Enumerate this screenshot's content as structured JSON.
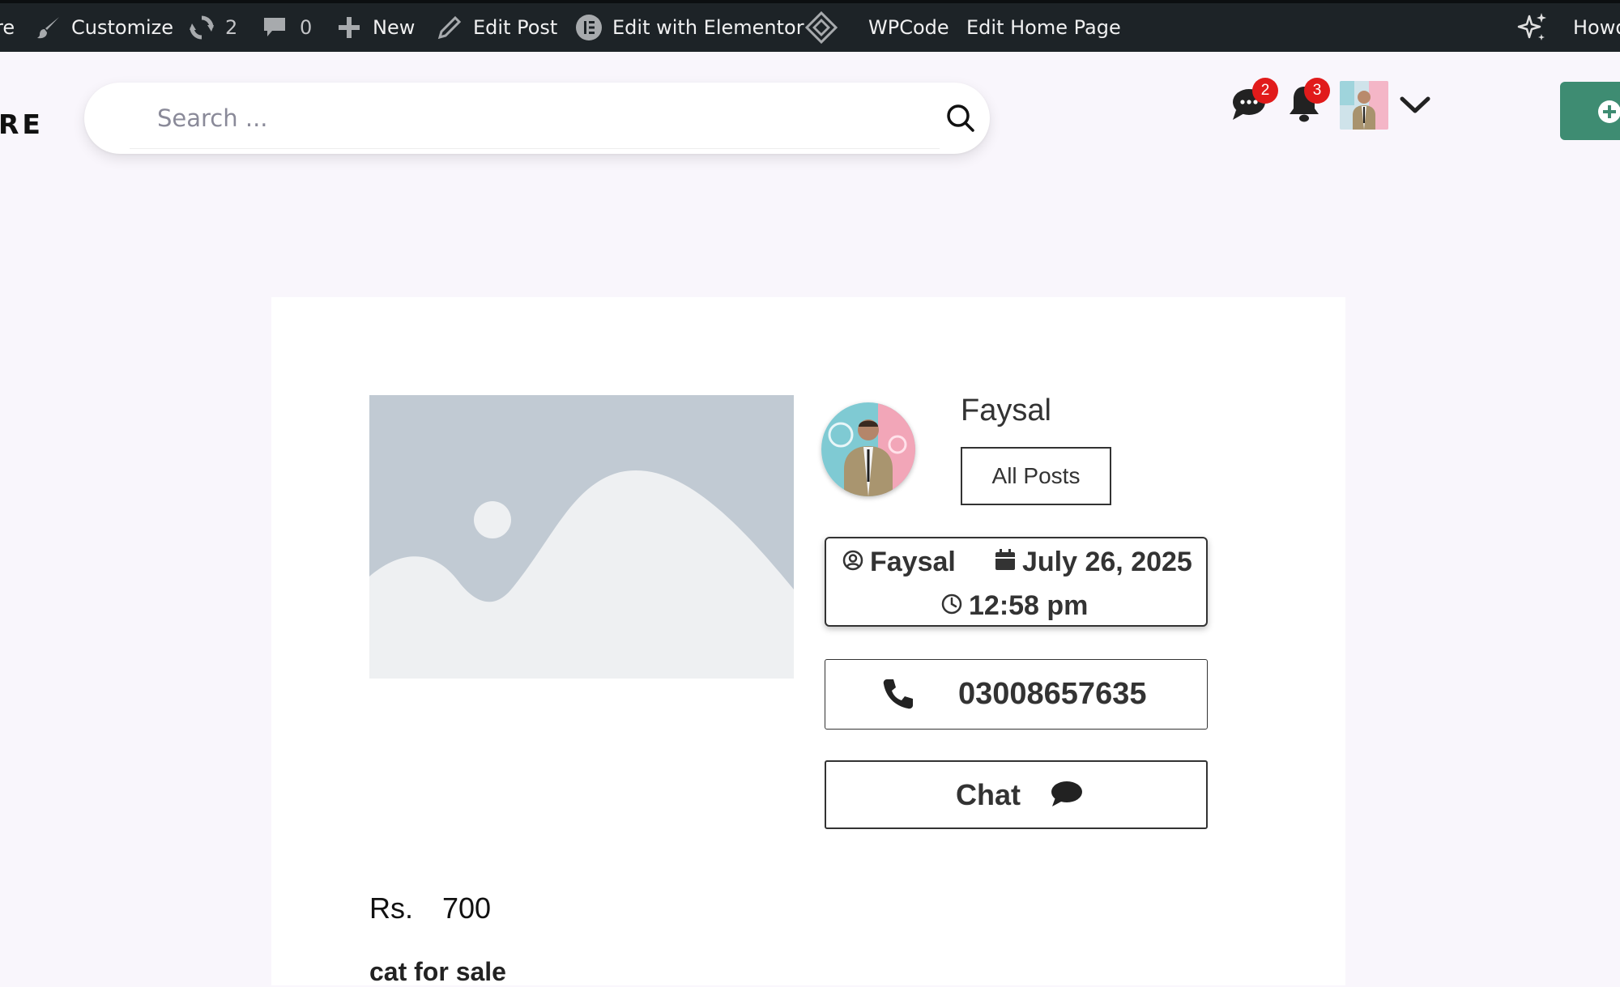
{
  "admin_bar": {
    "site_fragment": "re",
    "customize": "Customize",
    "updates_count": "2",
    "comments_count": "0",
    "new": "New",
    "edit_post": "Edit Post",
    "edit_elementor": "Edit with Elementor",
    "wpcode": "WPCode",
    "edit_home": "Edit Home Page",
    "howdy": "Howdy"
  },
  "header": {
    "brand_fragment": "RE",
    "search_placeholder": "Search ...",
    "messages_badge": "2",
    "notifications_badge": "3",
    "accent_color": "#3e8c72"
  },
  "post": {
    "author": "Faysal",
    "all_posts": "All Posts",
    "meta_author": "Faysal",
    "date": "July 26, 2025",
    "time": "12:58 pm",
    "phone": "03008657635",
    "chat": "Chat",
    "currency": "Rs.",
    "price": "700",
    "description": "cat for sale"
  },
  "icons": [
    "wordpress-brush-icon",
    "updates-icon",
    "comment-icon",
    "plus-icon",
    "pencil-icon",
    "elementor-icon",
    "wpcode-icon",
    "ai-sparkle-icon",
    "search-icon",
    "chat-bubble-icon",
    "bell-icon",
    "chevron-down-icon",
    "add-circle-icon",
    "user-circle-icon",
    "calendar-icon",
    "clock-icon",
    "phone-icon",
    "comment-icon"
  ]
}
